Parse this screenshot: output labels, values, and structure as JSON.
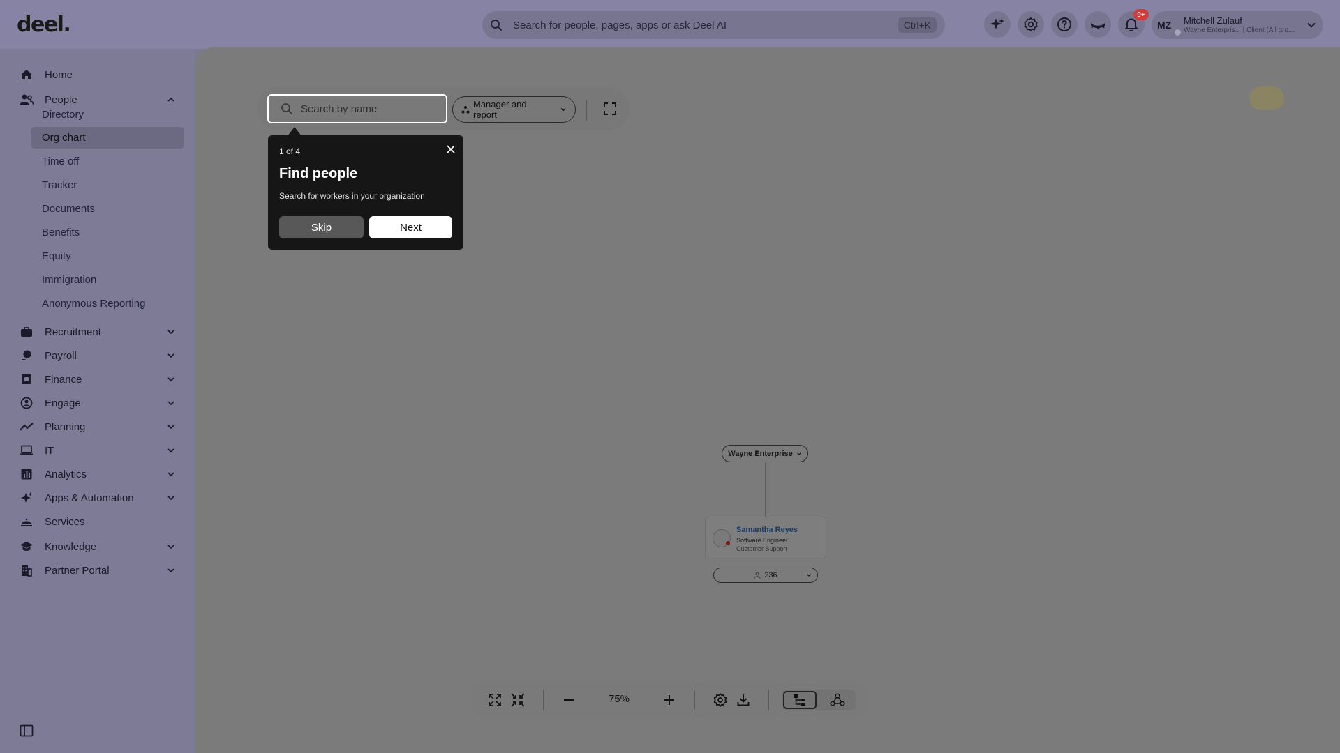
{
  "app": {
    "logo": "deel."
  },
  "topbar": {
    "search_placeholder": "Search for people, pages, apps or ask Deel AI",
    "search_shortcut": "Ctrl+K",
    "notifications_badge": "9+",
    "user": {
      "initials": "MZ",
      "name": "Mitchell Zulauf",
      "subtitle": "Wayne Enterpris... | Client (All gro..."
    }
  },
  "sidebar": {
    "home": "Home",
    "people": {
      "label": "People",
      "children": [
        {
          "label": "Directory",
          "active": false
        },
        {
          "label": "Org chart",
          "active": true
        },
        {
          "label": "Time off",
          "active": false
        },
        {
          "label": "Tracker",
          "active": false
        },
        {
          "label": "Documents",
          "active": false
        },
        {
          "label": "Benefits",
          "active": false
        },
        {
          "label": "Equity",
          "active": false
        },
        {
          "label": "Immigration",
          "active": false
        },
        {
          "label": "Anonymous Reporting",
          "active": false
        }
      ]
    },
    "sections": [
      {
        "label": "Recruitment",
        "icon": "briefcase-icon"
      },
      {
        "label": "Payroll",
        "icon": "payroll-icon"
      },
      {
        "label": "Finance",
        "icon": "wallet-icon"
      },
      {
        "label": "Engage",
        "icon": "engage-icon"
      },
      {
        "label": "Planning",
        "icon": "trend-icon"
      },
      {
        "label": "IT",
        "icon": "laptop-icon"
      },
      {
        "label": "Analytics",
        "icon": "bar-chart-icon"
      },
      {
        "label": "Apps & Automation",
        "icon": "sparkle-icon"
      },
      {
        "label": "Services",
        "icon": "cloche-icon"
      },
      {
        "label": "Knowledge",
        "icon": "graduation-cap-icon"
      },
      {
        "label": "Partner Portal",
        "icon": "building-icon"
      }
    ]
  },
  "orgchart": {
    "search_placeholder": "Search by name",
    "view_mode": "Manager and report",
    "root_label": "Wayne Enterprise",
    "person": {
      "name": "Samantha Reyes",
      "title": "Software Engineer",
      "department": "Customer Support"
    },
    "reports_count": "236",
    "zoom": "75%"
  },
  "tour": {
    "step": "1 of 4",
    "title": "Find people",
    "body": "Search for workers in your organization",
    "skip_label": "Skip",
    "next_label": "Next"
  },
  "colors": {
    "overlay": "#797a90",
    "tour_bg": "#161616",
    "person_name": "#1c3c63",
    "badge": "#cf3d3d"
  }
}
